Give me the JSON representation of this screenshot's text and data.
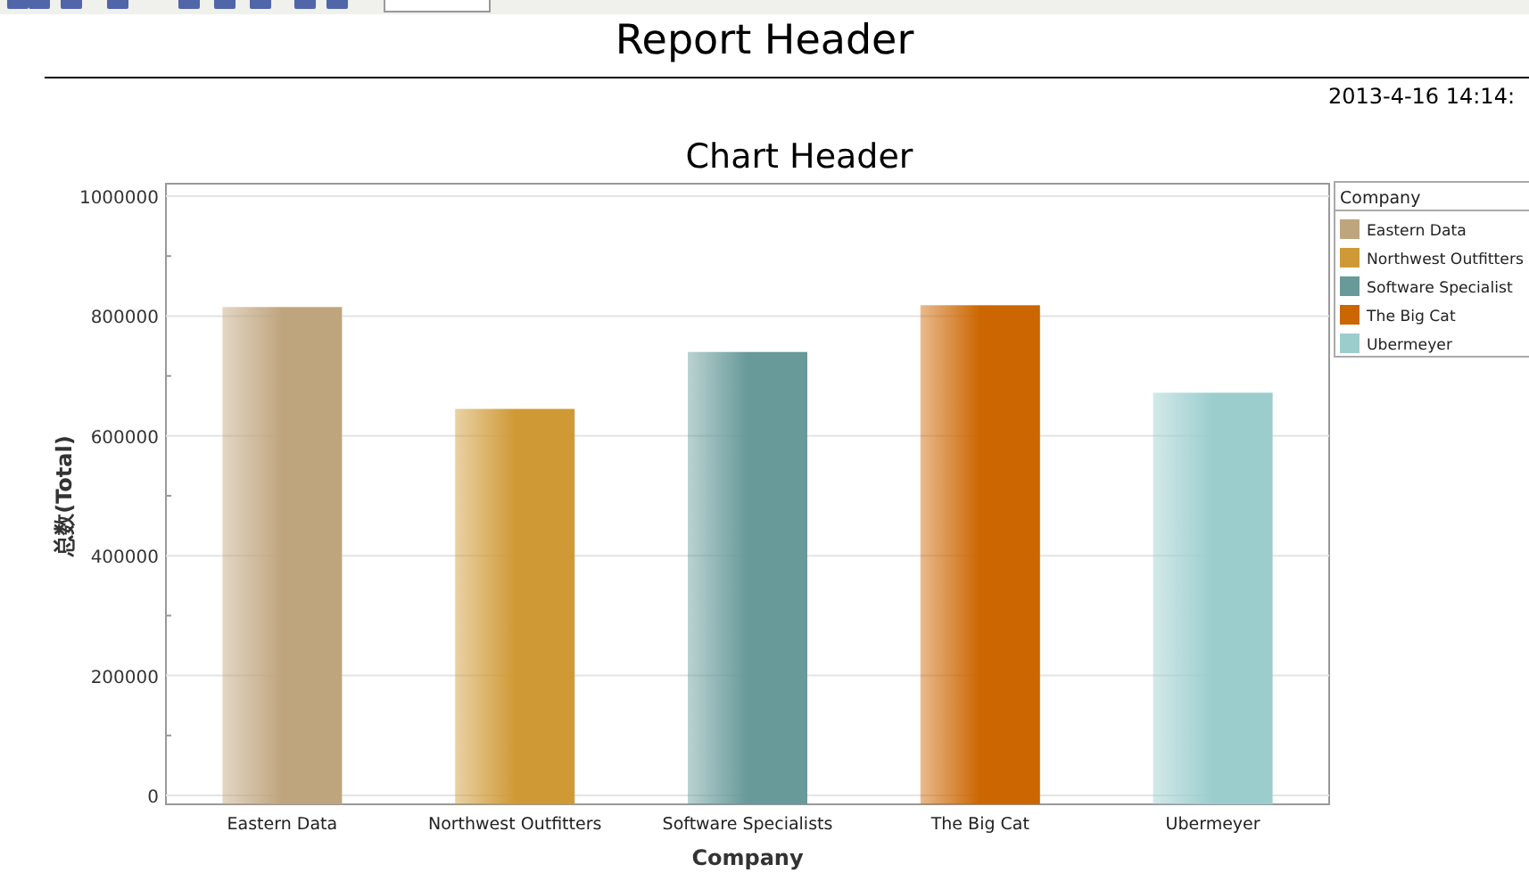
{
  "report": {
    "title": "Report Header",
    "timestamp": "2013-4-16 14:14:"
  },
  "chart": {
    "chart_data": {
      "type": "bar",
      "title": "Chart Header",
      "xlabel": "Company",
      "ylabel": "总数(Total)",
      "categories": [
        "Eastern Data",
        "Northwest Outfitters",
        "Software Specialists",
        "The Big Cat",
        "Ubermeyer"
      ],
      "values": [
        815000,
        645000,
        740000,
        818000,
        672000
      ],
      "grid": true,
      "ylim": [
        0,
        1000000
      ],
      "yticks": [
        0,
        200000,
        400000,
        600000,
        800000,
        1000000
      ]
    },
    "legend": {
      "title": "Company",
      "items": [
        {
          "label": "Eastern Data",
          "color": "#bfa57e"
        },
        {
          "label": "Northwest Outfitters",
          "color": "#cf9a36"
        },
        {
          "label": "Software Specialist",
          "color": "#679a99"
        },
        {
          "label": "The Big Cat",
          "color": "#cc6600"
        },
        {
          "label": "Ubermeyer",
          "color": "#9ccdcd"
        }
      ]
    }
  }
}
